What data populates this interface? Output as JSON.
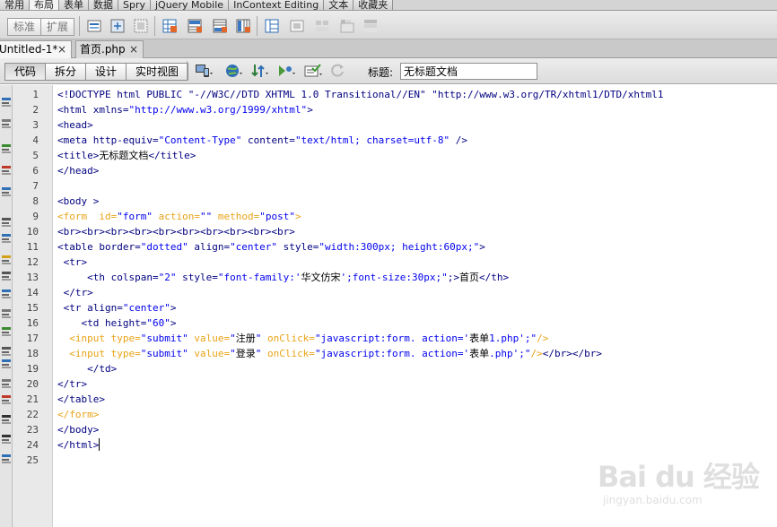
{
  "insert_panel": {
    "tabs": [
      {
        "label": "常用",
        "active": false
      },
      {
        "label": "布局",
        "active": true
      },
      {
        "label": "表单",
        "active": false
      },
      {
        "label": "数据",
        "active": false
      },
      {
        "label": "Spry",
        "active": false
      },
      {
        "label": "jQuery Mobile",
        "active": false
      },
      {
        "label": "InContext Editing",
        "active": false
      },
      {
        "label": "文本",
        "active": false
      },
      {
        "label": "收藏夹",
        "active": false
      }
    ],
    "mode_buttons": [
      "标准",
      "扩展"
    ],
    "icons": [
      "insert-div-icon",
      "ap-div-icon",
      "fluid-grid-icon",
      "table-icon",
      "insert-row-above-icon",
      "insert-row-below-icon",
      "insert-column-left-icon",
      "insert-column-right-icon",
      "frames-icon",
      "iframe-icon",
      "spry-menu-icon",
      "spry-tabbed-icon",
      "spry-accordion-icon"
    ]
  },
  "document_tabs": [
    {
      "label": "Untitled-1*",
      "active": true,
      "close": "×"
    },
    {
      "label": "首页.php",
      "active": false,
      "close": "×"
    }
  ],
  "document_toolbar": {
    "view_buttons": [
      {
        "label": "代码",
        "active": true
      },
      {
        "label": "拆分",
        "active": false
      },
      {
        "label": "设计",
        "active": false
      },
      {
        "label": "实时视图",
        "active": false
      }
    ],
    "title_label": "标题:",
    "title_value": "无标题文档",
    "icons": [
      "multiscreen-icon",
      "preview-browser-icon",
      "file-management-icon",
      "check-browser-icon",
      "validate-markup-icon",
      "refresh-icon"
    ]
  },
  "coding_toolbar_icons": [
    "open-documents-icon",
    "collapse-tag-icon",
    "collapse-selection-icon",
    "expand-all-icon",
    "select-parent-tag-icon",
    "balance-braces-icon",
    "line-numbers-icon",
    "highlight-invalid-icon",
    "syntax-coloring-icon",
    "word-wrap-icon",
    "info-bar-icon",
    "apply-comment-icon",
    "remove-comment-icon",
    "wrap-tag-icon",
    "recent-snippets-icon",
    "move-css-icon",
    "indent-icon",
    "outdent-icon",
    "format-source-icon"
  ],
  "colors": {
    "tag_blue": "#000080",
    "tag_orange": "#e8a317",
    "attr_value": "#0000ee"
  },
  "code": {
    "lines": [
      [
        [
          "tb",
          "<!DOCTYPE html PUBLIC \"-//W3C//DTD XHTML 1.0 Transitional//EN\" \"http://www.w3.org/TR/xhtml1/DTD/xhtml1"
        ]
      ],
      [
        [
          "tb",
          "<html "
        ],
        [
          "at",
          "xmlns="
        ],
        [
          "av",
          "\"http://www.w3.org/1999/xhtml\""
        ],
        [
          "tb",
          ">"
        ]
      ],
      [
        [
          "tb",
          "<head>"
        ]
      ],
      [
        [
          "tb",
          "<meta "
        ],
        [
          "at",
          "http-equiv="
        ],
        [
          "av",
          "\"Content-Type\""
        ],
        [
          "at",
          " content="
        ],
        [
          "av",
          "\"text/html; charset=utf-8\""
        ],
        [
          "tb",
          " />"
        ]
      ],
      [
        [
          "tb",
          "<title>"
        ],
        [
          "tx",
          "无标题文档"
        ],
        [
          "tb",
          "</title>"
        ]
      ],
      [
        [
          "tb",
          "</head>"
        ]
      ],
      [],
      [
        [
          "tb",
          "<body >"
        ]
      ],
      [
        [
          "to",
          "<form  "
        ],
        [
          "to",
          "id="
        ],
        [
          "av",
          "\"form\""
        ],
        [
          "to",
          " action="
        ],
        [
          "av",
          "\"\""
        ],
        [
          "to",
          " method="
        ],
        [
          "av",
          "\"post\""
        ],
        [
          "to",
          ">"
        ]
      ],
      [
        [
          "tb",
          "<br><br><br><br><br><br><br><br><br><br>"
        ]
      ],
      [
        [
          "tb",
          "<table "
        ],
        [
          "at",
          "border="
        ],
        [
          "av",
          "\"dotted\""
        ],
        [
          "at",
          " align="
        ],
        [
          "av",
          "\"center\""
        ],
        [
          "at",
          " style="
        ],
        [
          "av",
          "\"width:300px; height:60px;\""
        ],
        [
          "tb",
          ">"
        ]
      ],
      [
        [
          "tb",
          " <tr>"
        ]
      ],
      [
        [
          "tb",
          "     <th "
        ],
        [
          "at",
          "colspan="
        ],
        [
          "av",
          "\"2\""
        ],
        [
          "at",
          " style="
        ],
        [
          "av",
          "\"font-family:'"
        ],
        [
          "tx",
          "华文仿宋"
        ],
        [
          "av",
          "';font-size:30px;\""
        ],
        [
          "tb",
          ";>"
        ],
        [
          "tx",
          "首页"
        ],
        [
          "tb",
          "</th>"
        ]
      ],
      [
        [
          "tb",
          " </tr>"
        ]
      ],
      [
        [
          "tb",
          " <tr "
        ],
        [
          "at",
          "align="
        ],
        [
          "av",
          "\"center\""
        ],
        [
          "tb",
          ">"
        ]
      ],
      [
        [
          "tb",
          "    <td "
        ],
        [
          "at",
          "height="
        ],
        [
          "av",
          "\"60\""
        ],
        [
          "tb",
          ">"
        ]
      ],
      [
        [
          "to",
          "  <input "
        ],
        [
          "to",
          "type="
        ],
        [
          "av",
          "\"submit\""
        ],
        [
          "to",
          " value="
        ],
        [
          "av",
          "\""
        ],
        [
          "tx",
          "注册"
        ],
        [
          "av",
          "\""
        ],
        [
          "to",
          " onClick="
        ],
        [
          "av",
          "\"javascript:form. action='"
        ],
        [
          "tx",
          "表单"
        ],
        [
          "av",
          "1.php';\""
        ],
        [
          "to",
          "/>"
        ]
      ],
      [
        [
          "to",
          "  <input "
        ],
        [
          "to",
          "type="
        ],
        [
          "av",
          "\"submit\""
        ],
        [
          "to",
          " value="
        ],
        [
          "av",
          "\""
        ],
        [
          "tx",
          "登录"
        ],
        [
          "av",
          "\""
        ],
        [
          "to",
          " onClick="
        ],
        [
          "av",
          "\"javascript:form. action='"
        ],
        [
          "tx",
          "表单"
        ],
        [
          "av",
          ".php';\""
        ],
        [
          "to",
          "/>"
        ],
        [
          "tb",
          "</br></br>"
        ]
      ],
      [
        [
          "tb",
          "     </td>"
        ]
      ],
      [
        [
          "tb",
          "</tr>"
        ]
      ],
      [
        [
          "tb",
          "</table>"
        ]
      ],
      [
        [
          "to",
          "</form>"
        ]
      ],
      [
        [
          "tb",
          "</body>"
        ]
      ],
      [
        [
          "tb",
          "</html>"
        ]
      ],
      []
    ]
  },
  "watermark": {
    "brand": "Bai du 经验",
    "url": "jingyan.baidu.com"
  }
}
